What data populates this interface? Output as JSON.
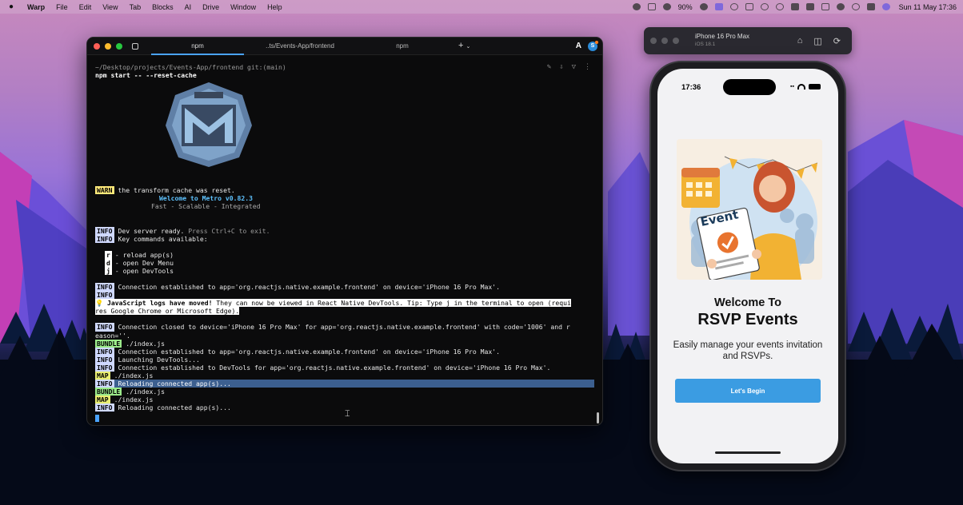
{
  "menubar": {
    "app": "Warp",
    "items": [
      "File",
      "Edit",
      "View",
      "Tab",
      "Blocks",
      "AI",
      "Drive",
      "Window",
      "Help"
    ],
    "battery_text": "90%",
    "datetime": "Sun 11 May  17:36"
  },
  "terminal": {
    "tabs": [
      {
        "label": "npm",
        "active": true
      },
      {
        "label": "..ts/Events-App/frontend",
        "active": false
      },
      {
        "label": "npm",
        "active": false
      }
    ],
    "path": "~/Desktop/projects/Events-App/frontend git:(main)",
    "command": "npm start -- --reset-cache",
    "warn_tag": "WARN",
    "warn_text": "the transform cache was reset.",
    "welcome": "Welcome to Metro v0.82.3",
    "slogan": "Fast - Scalable - Integrated",
    "info_tag": "INFO",
    "bundle_tag": "BUNDLE",
    "map_tag": "MAP",
    "dev_ready": "Dev server ready.",
    "press_hint": "Press Ctrl+C to exit.",
    "key_commands": "Key commands available:",
    "keys": [
      {
        "key": "r",
        "desc": "- reload app(s)"
      },
      {
        "key": "d",
        "desc": "- open Dev Menu"
      },
      {
        "key": "j",
        "desc": "- open DevTools"
      }
    ],
    "conn1": "Connection established to app='org.reactjs.native.example.frontend' on device='iPhone 16 Pro Max'.",
    "tip_bold": "JavaScript logs have moved!",
    "tip_rest": "They can now be viewed in React Native DevTools. Tip: Type j in the terminal to open (requi",
    "tip_line2": "res Google Chrome or Microsoft Edge).",
    "closed1": "Connection closed to device='iPhone 16 Pro Max' for app='org.reactjs.native.example.frontend' with code='1006' and r",
    "closed2": "eason=''.",
    "bundle1": "./index.js",
    "conn2": "Connection established to app='org.reactjs.native.example.frontend' on device='iPhone 16 Pro Max'.",
    "launching": "Launching DevTools...",
    "conn3": "Connection established to DevTools for app='org.reactjs.native.example.frontend' on device='iPhone 16 Pro Max'.",
    "map1": "./index.js",
    "reloading1": "Reloading connected app(s)...",
    "bundle2": "./index.js",
    "map2": "./index.js",
    "reloading2": "Reloading connected app(s)..."
  },
  "simulator": {
    "device": "iPhone 16 Pro Max",
    "os": "iOS 18.1"
  },
  "phone": {
    "time": "17:36",
    "illustration_word": "Event",
    "welcome": "Welcome To",
    "title": "RSVP Events",
    "tagline": "Easily manage your events invitation and RSVPs.",
    "button": "Let's Begin"
  },
  "colors": {
    "accent_blue": "#3b9ce2",
    "warn": "#ffe97a",
    "info": "#cfd8ff",
    "bundle": "#9bea8a"
  }
}
